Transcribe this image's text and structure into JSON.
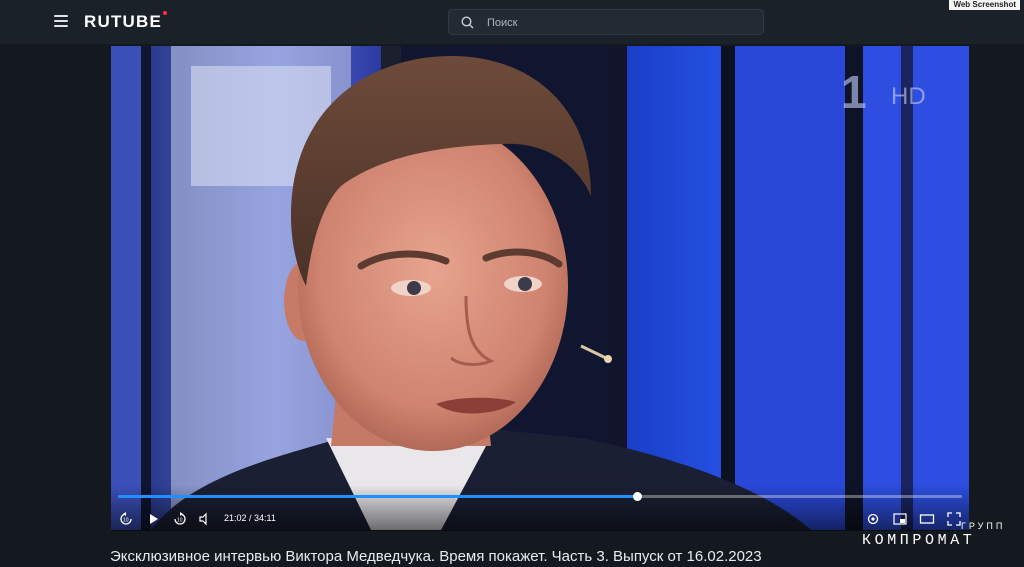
{
  "header": {
    "logo": "RUTUBE",
    "search_placeholder": "Поиск",
    "screenshot_badge": "Web Screenshot"
  },
  "player": {
    "channel_badge_hd": "HD",
    "time": {
      "current": "21:02",
      "total": "34:11",
      "display": "21:02 / 34:11"
    },
    "progress": 0.615,
    "controls": [
      "rewind-10",
      "play",
      "forward-10",
      "volume",
      "settings",
      "picture-in-picture",
      "theater-mode",
      "fullscreen"
    ]
  },
  "video": {
    "title": "Эксклюзивное интервью Виктора Медведчука. Время покажет. Часть 3. Выпуск от 16.02.2023"
  },
  "watermark": {
    "top": "ГРУПП",
    "main": "КОМПРОМАТ"
  },
  "colors": {
    "accent": "#1e90ff",
    "logo_dot": "#ff2b4f",
    "background": "#14191f"
  }
}
